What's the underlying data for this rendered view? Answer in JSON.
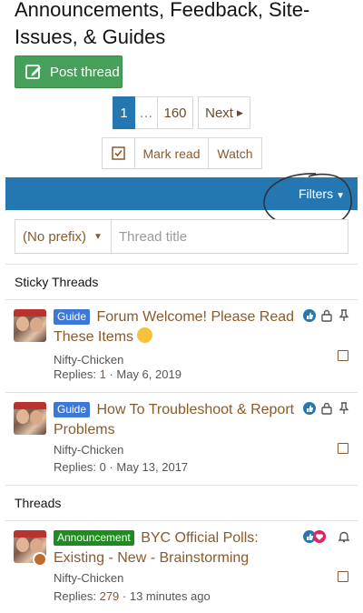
{
  "page": {
    "title": "Announcements, Feedback, Site-Issues, & Guides"
  },
  "post_button": {
    "label": "Post thread"
  },
  "pagination": {
    "current": "1",
    "gap": "…",
    "last": "160",
    "next": "Next"
  },
  "actions": {
    "mark_read": "Mark read",
    "watch": "Watch"
  },
  "filter_bar": {
    "filters_label": "Filters"
  },
  "filter_inputs": {
    "prefix": "(No prefix)",
    "title_placeholder": "Thread title"
  },
  "sections": {
    "sticky": "Sticky Threads",
    "threads": "Threads"
  },
  "sticky_threads": [
    {
      "label": "Guide",
      "title": "Forum Welcome! Please Read These Items",
      "author": "Nifty-Chicken",
      "replies_label": "Replies:",
      "replies": "1",
      "date": "May 6, 2019"
    },
    {
      "label": "Guide",
      "title": "How To Troubleshoot & Report Problems",
      "author": "Nifty-Chicken",
      "replies_label": "Replies:",
      "replies": "0",
      "date": "May 13, 2017"
    }
  ],
  "threads": [
    {
      "label": "Announcement",
      "title": "BYC Official Polls: Existing - New - Brainstorming",
      "author": "Nifty-Chicken",
      "replies_label": "Replies:",
      "replies": "279",
      "date": "13 minutes ago"
    }
  ],
  "colors": {
    "accent": "#2577b1",
    "post_button": "#47a05a",
    "link": "#8a5a2b",
    "guide_label": "#3c78d8",
    "announcement_label": "#1e8c1e"
  }
}
